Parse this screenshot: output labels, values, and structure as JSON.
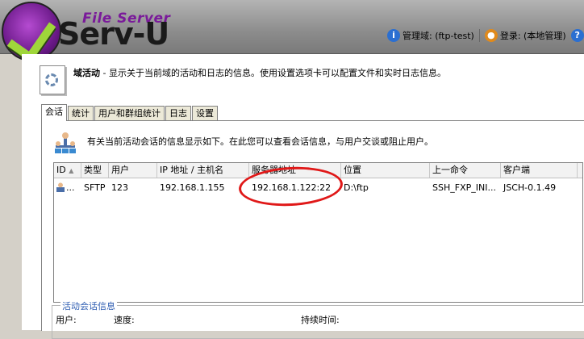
{
  "header": {
    "logo_sub": "File Server",
    "logo_main": "Serv-U",
    "domain_label": "管理域: (ftp-test)",
    "login_label": "登录: (本地管理)",
    "domain_icon": "info-icon",
    "login_icon": "user-login-icon",
    "help_icon": "help-icon"
  },
  "info": {
    "title": "域活动",
    "text": " - 显示关于当前域的活动和日志的信息。使用设置选项卡可以配置文件和实时日志信息。"
  },
  "tabs": [
    {
      "label": "会话",
      "active": true
    },
    {
      "label": "统计",
      "active": false
    },
    {
      "label": "用户和群组统计",
      "active": false
    },
    {
      "label": "日志",
      "active": false
    },
    {
      "label": "设置",
      "active": false
    }
  ],
  "panel": {
    "description": "有关当前活动会话的信息显示如下。在此您可以查看会话信息，与用户交谈或阻止用户。"
  },
  "table": {
    "columns": [
      "ID",
      "类型",
      "用户",
      "IP 地址 / 主机名",
      "服务器地址",
      "位置",
      "上一命令",
      "客户端"
    ],
    "rows": [
      {
        "id": "...",
        "type": "SFTP",
        "user": "123",
        "ip": "192.168.1.155",
        "server": "192.168.1.122:22",
        "location": "D:\\ftp",
        "last_command": "SSH_FXP_INI...",
        "client": "JSCH-0.1.49"
      }
    ]
  },
  "activity": {
    "title": "活动会话信息",
    "user_label": "用户:",
    "speed_label": "速度:",
    "duration_label": "持续时间:"
  },
  "colors": {
    "accent": "#2a5ab0",
    "annotation": "#e01818",
    "logo_purple": "#7a1a9a",
    "logo_green": "#9fd63a"
  }
}
